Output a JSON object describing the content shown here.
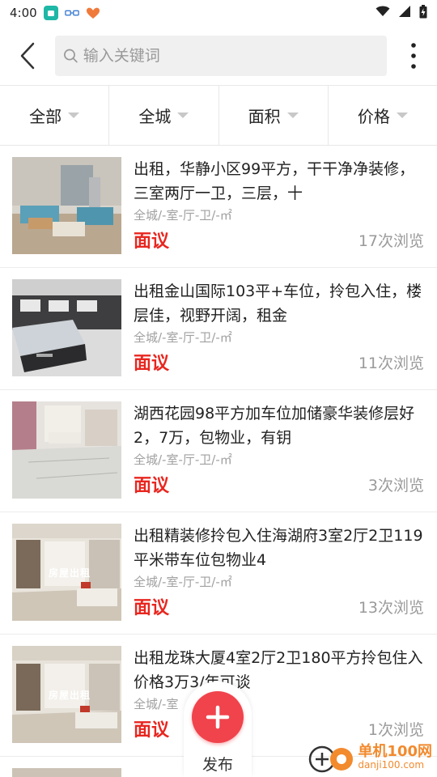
{
  "status": {
    "time": "4:00",
    "colors": {
      "app1": "#1fb7a6",
      "app2": "#3a7bd5",
      "app3": "#f07a3a"
    }
  },
  "search": {
    "placeholder": "输入关键词"
  },
  "filters": [
    "全部",
    "全城",
    "面积",
    "价格"
  ],
  "listings": [
    {
      "title": "出租，华静小区99平方，干干净净装修，三室两厅一卫，三层，十",
      "meta": "全城/-室-厅-卫/-㎡",
      "price": "面议",
      "views": "17次浏览",
      "overlay": ""
    },
    {
      "title": "出租金山国际103平+车位，拎包入住，楼层佳，视野开阔，租金",
      "meta": "全城/-室-厅-卫/-㎡",
      "price": "面议",
      "views": "11次浏览",
      "overlay": ""
    },
    {
      "title": "湖西花园98平方加车位加储豪华装修层好2，7万，包物业，有钥",
      "meta": "全城/-室-厅-卫/-㎡",
      "price": "面议",
      "views": "3次浏览",
      "overlay": ""
    },
    {
      "title": "出租精装修拎包入住海湖府3室2厅2卫119平米带车位包物业4",
      "meta": "全城/-室-厅-卫/-㎡",
      "price": "面议",
      "views": "13次浏览",
      "overlay": "房屋出租"
    },
    {
      "title": "出租龙珠大厦4室2厅2卫180平方拎包住入价格3万3/年可谈",
      "meta": "全城/-室",
      "price": "面议",
      "views": "1次浏览",
      "overlay": "房屋出租"
    }
  ],
  "fab": {
    "label": "发布"
  },
  "watermark": {
    "main": "单机100网",
    "sub": "danji100.com"
  },
  "colors": {
    "accent": "#e8261f",
    "fab": "#f0434c"
  }
}
